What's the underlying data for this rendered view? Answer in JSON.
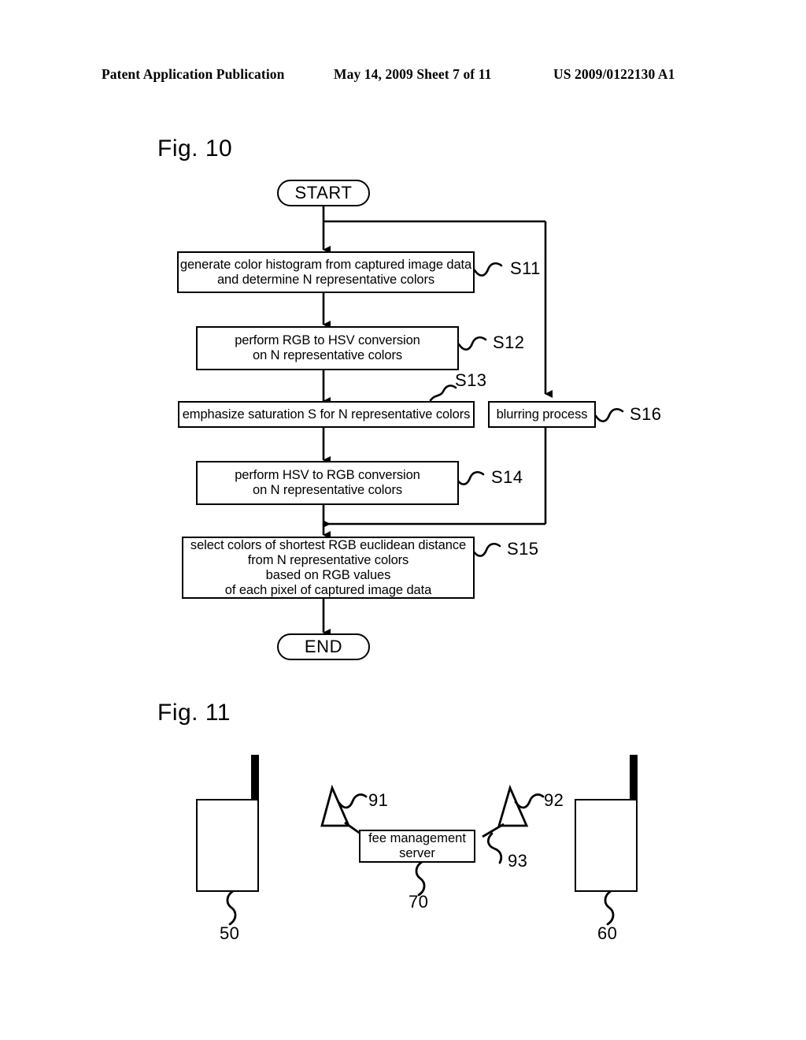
{
  "header": {
    "left": "Patent Application Publication",
    "middle": "May 14, 2009  Sheet 7 of 11",
    "right": "US 2009/0122130 A1"
  },
  "figures": [
    {
      "caption": "Fig. 10",
      "type": "flowchart",
      "nodes": {
        "start": "START",
        "end": "END",
        "s11": "generate color histogram from captured image data\nand determine N representative colors",
        "s12": "perform RGB to HSV conversion\non N representative colors",
        "s13": "emphasize saturation S for N representative colors",
        "s14": "perform HSV to RGB conversion\non N representative colors",
        "s15": "select colors of shortest RGB euclidean distance\nfrom N representative colors\nbased on RGB values\nof each pixel of captured image data",
        "s16": "blurring process"
      },
      "step_labels": {
        "s11": "S11",
        "s12": "S12",
        "s13": "S13",
        "s14": "S14",
        "s15": "S15",
        "s16": "S16"
      }
    },
    {
      "caption": "Fig. 11",
      "type": "system-diagram",
      "server_label": "fee management\nserver",
      "refs": {
        "handset_left": "50",
        "handset_right": "60",
        "server": "70",
        "antenna_left": "91",
        "antenna_right": "92",
        "link_right": "93"
      }
    }
  ],
  "colors": {
    "ink": "#000000",
    "paper": "#ffffff"
  }
}
